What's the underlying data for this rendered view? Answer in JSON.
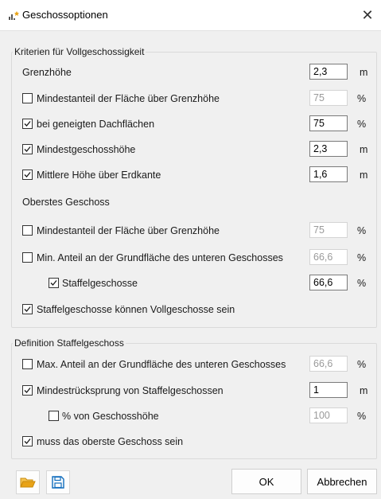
{
  "window": {
    "title": "Geschossoptionen",
    "close_glyph": "✕"
  },
  "group1": {
    "label": "Kriterien für Vollgeschossigkeit",
    "grenzhoehe": {
      "label": "Grenzhöhe",
      "value": "2,3",
      "unit": "m"
    },
    "mindestanteil": {
      "label": "Mindestanteil der Fläche über Grenzhöhe",
      "checked": false,
      "value": "75",
      "unit": "%",
      "disabled": true
    },
    "geneigte": {
      "label": "bei geneigten Dachflächen",
      "checked": true,
      "value": "75",
      "unit": "%",
      "disabled": false
    },
    "mindestgeschoss": {
      "label": "Mindestgeschosshöhe",
      "checked": true,
      "value": "2,3",
      "unit": "m",
      "disabled": false
    },
    "mittlere": {
      "label": "Mittlere Höhe über Erdkante",
      "checked": true,
      "value": "1,6",
      "unit": "m",
      "disabled": false
    }
  },
  "group_oberstes": {
    "label": "Oberstes Geschoss",
    "mindestanteil": {
      "label": "Mindestanteil der Fläche über Grenzhöhe",
      "checked": false,
      "value": "75",
      "unit": "%",
      "disabled": true
    },
    "min_anteil": {
      "label": "Min. Anteil an der Grundfläche des unteren Geschosses",
      "checked": false,
      "value": "66,6",
      "unit": "%",
      "disabled": true
    },
    "staffel": {
      "label": "Staffelgeschosse",
      "checked": true,
      "value": "66,6",
      "unit": "%",
      "disabled": false
    },
    "staffel_voll": {
      "label": "Staffelgeschosse können Vollgeschosse sein",
      "checked": true
    }
  },
  "group2": {
    "label": "Definition Staffelgeschoss",
    "max_anteil": {
      "label": "Max. Anteil an der Grundfläche des unteren Geschosses",
      "checked": false,
      "value": "66,6",
      "unit": "%",
      "disabled": true
    },
    "ruecksprung": {
      "label": "Mindestrücksprung von Staffelgeschossen",
      "checked": true,
      "value": "1",
      "unit": "m",
      "disabled": false
    },
    "pct_geschoss": {
      "label": "% von Geschosshöhe",
      "checked": false,
      "value": "100",
      "unit": "%",
      "disabled": true
    },
    "oberstes": {
      "label": "muss das oberste Geschoss sein",
      "checked": true
    }
  },
  "footer": {
    "ok_label": "OK",
    "cancel_label": "Abbrechen",
    "open_icon": "folder-open-icon",
    "save_icon": "floppy-disk-icon"
  },
  "colors": {
    "accent": "#0f6cbd",
    "folder": "#e8a317"
  }
}
